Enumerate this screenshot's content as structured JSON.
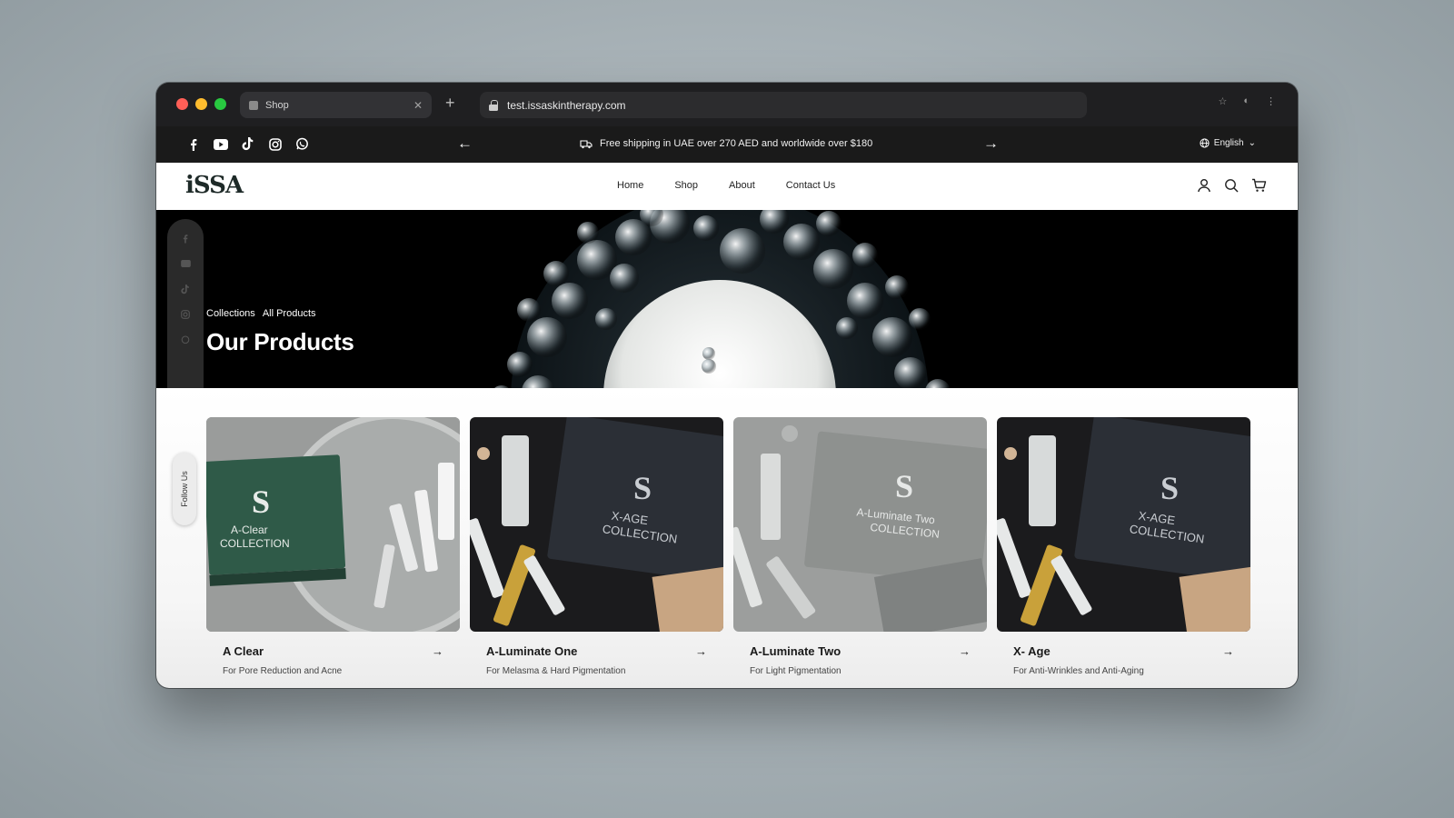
{
  "browser": {
    "tab_title": "Shop",
    "url": "test.issaskintherapy.com"
  },
  "announcement": {
    "text": "Free shipping in UAE over 270 AED and worldwide over $180",
    "language": "English"
  },
  "header": {
    "logo": "iSSA",
    "nav": [
      "Home",
      "Shop",
      "About",
      "Contact Us"
    ]
  },
  "hero": {
    "breadcrumb": [
      "Collections",
      "All Products"
    ],
    "title": "Our Products"
  },
  "follow_label": "Follow Us",
  "products": [
    {
      "name": "A Clear",
      "subtitle": "For Pore Reduction and Acne",
      "box_title": "A-Clear",
      "box_sub": "COLLECTION",
      "theme": "#2f5a48"
    },
    {
      "name": "A-Luminate One",
      "subtitle": "For Melasma & Hard Pigmentation",
      "box_title": "X-AGE",
      "box_sub": "COLLECTION",
      "theme": "#2b2f36"
    },
    {
      "name": "A-Luminate Two",
      "subtitle": "For Light Pigmentation",
      "box_title": "A-Luminate Two",
      "box_sub": "COLLECTION",
      "theme": "#8e918f"
    },
    {
      "name": "X- Age",
      "subtitle": "For Anti-Wrinkles and Anti-Aging",
      "box_title": "X-AGE",
      "box_sub": "COLLECTION",
      "theme": "#2b2f36"
    }
  ],
  "colors": {
    "accent_dark": "#1e2a28",
    "chrome_bg": "#1f1f21",
    "announce_bg": "#1a1a1a"
  }
}
